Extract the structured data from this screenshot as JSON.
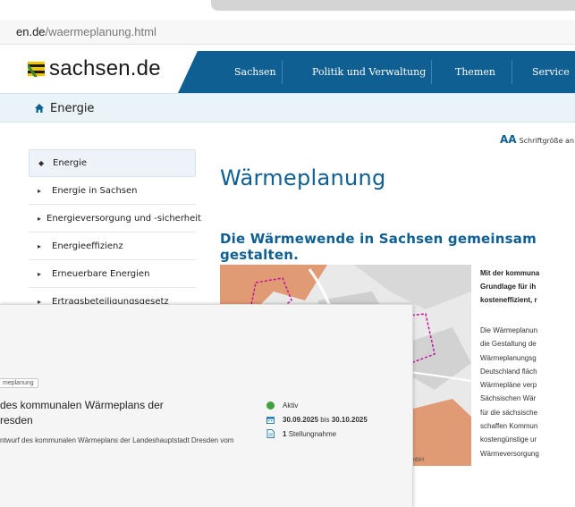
{
  "browser": {
    "url_host": "en.de",
    "url_path": "/waermeplanung.html"
  },
  "header": {
    "logo_text": "sachsen.de",
    "nav": [
      "Sachsen",
      "Politik und Verwaltung",
      "Themen",
      "Service"
    ]
  },
  "breadcrumb": {
    "label": "Energie"
  },
  "tools": {
    "fontsize_icon": "AA",
    "fontsize_label": "Schriftgröße an"
  },
  "sidebar": {
    "items": [
      {
        "marker": "◆",
        "label": "Energie"
      },
      {
        "marker": "▸",
        "label": "Energie in Sachsen"
      },
      {
        "marker": "▸",
        "label": "Energieversorgung und -sicherheit"
      },
      {
        "marker": "▸",
        "label": "Energieeffizienz"
      },
      {
        "marker": "▸",
        "label": "Erneuerbare Energien"
      },
      {
        "marker": "▸",
        "label": "Ertragsbeteiligungsgesetz"
      }
    ]
  },
  "main": {
    "title": "Wärmeplanung",
    "subtitle": "Die Wärmewende in Sachsen gemeinsam gestalten.",
    "map_caption": "Infrastruktur mbH",
    "bold_lines": [
      "Mit der kommuna",
      "Grundlage für ih",
      "kosteneffizient, r"
    ],
    "body_lines": [
      "Die Wärmeplanun",
      "die Gestaltung de",
      "Wärmeplanungsg",
      "Deutschland fläch",
      "Wärmepläne verp",
      "Sächsischen Wär",
      "für die sächsische",
      "schaffen Kommun",
      "kostengünstige ur",
      "Wärmeversorgung"
    ]
  },
  "overlay": {
    "badge": "meplanung",
    "title": "des kommunalen Wärmeplans der\nresden",
    "description": "ntwurf des kommunalen Wärmeplans der Landeshauptstadt Dresden vom",
    "status": "Aktiv",
    "date_from": "30.09.2025",
    "date_sep": "bis",
    "date_to": "30.10.2025",
    "comments_count": "1",
    "comments_label": "Stellungnahme"
  },
  "colors": {
    "brand_blue": "#0f5f92",
    "status_green": "#3ea33e",
    "map_orange": "#e09a74",
    "boundary_magenta": "#c0149a"
  }
}
